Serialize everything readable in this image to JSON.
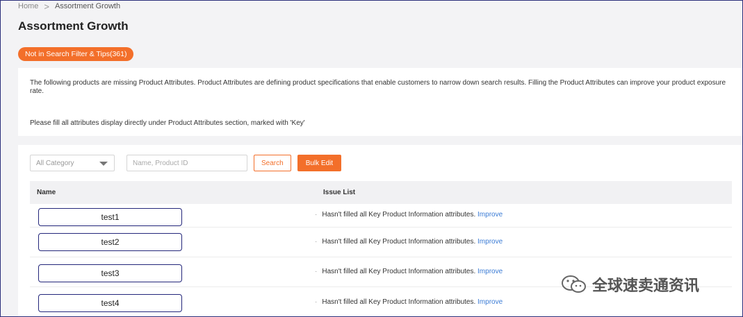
{
  "breadcrumb": {
    "home": "Home",
    "separator": ">",
    "current": "Assortment Growth"
  },
  "page": {
    "title": "Assortment Growth"
  },
  "tip_pill": {
    "label": "Not in Search Filter & Tips(361)"
  },
  "info": {
    "line1": "The following products are missing Product Attributes. Product Attributes are defining product specifications that enable customers to narrow down search results. Filling the Product Attributes can improve your product exposure rate.",
    "line2": "Please fill all attributes display directly under Product Attributes section, marked with 'Key'"
  },
  "filters": {
    "category": "All Category",
    "search_placeholder": "Name, Product ID",
    "search_label": "Search",
    "bulk_edit_label": "Bulk Edit"
  },
  "table": {
    "headers": {
      "name": "Name",
      "issue": "Issue List"
    },
    "rows": [
      {
        "name": "test1",
        "issue": "Hasn't filled all Key Product Information attributes.",
        "action": "Improve"
      },
      {
        "name": "test2",
        "issue": "Hasn't filled all Key Product Information attributes.",
        "action": "Improve"
      },
      {
        "name": "test3",
        "issue": "Hasn't filled all Key Product Information attributes.",
        "action": "Improve"
      },
      {
        "name": "test4",
        "issue": "Hasn't filled all Key Product Information attributes.",
        "action": "Improve"
      }
    ]
  },
  "watermark": {
    "text": "全球速卖通资讯",
    "icon": "wechat-icon"
  },
  "colors": {
    "accent": "#f36f2a",
    "link": "#3a7bd5",
    "name_box_border": "#23267a"
  }
}
